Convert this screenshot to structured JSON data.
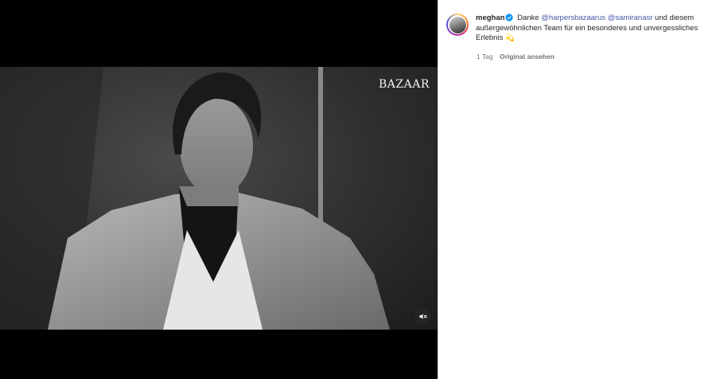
{
  "media": {
    "watermark": "BAZAAR",
    "mute_icon": "speaker-muted-icon"
  },
  "post": {
    "username": "meghan",
    "verified_icon": "verified-badge-icon",
    "caption_start": "Danke",
    "mention_1": "@harpersbazaarus",
    "mention_2": "@samiranasr",
    "caption_rest": "und diesem außergewöhnlichen Team für ein besonderes und unvergessliches Erlebnis",
    "caption_emoji": "💫",
    "timestamp": "1 Tag",
    "see_original": "Original ansehen"
  },
  "colors": {
    "link": "#4158a6",
    "verified": "#0095f6",
    "meta": "#737373"
  }
}
